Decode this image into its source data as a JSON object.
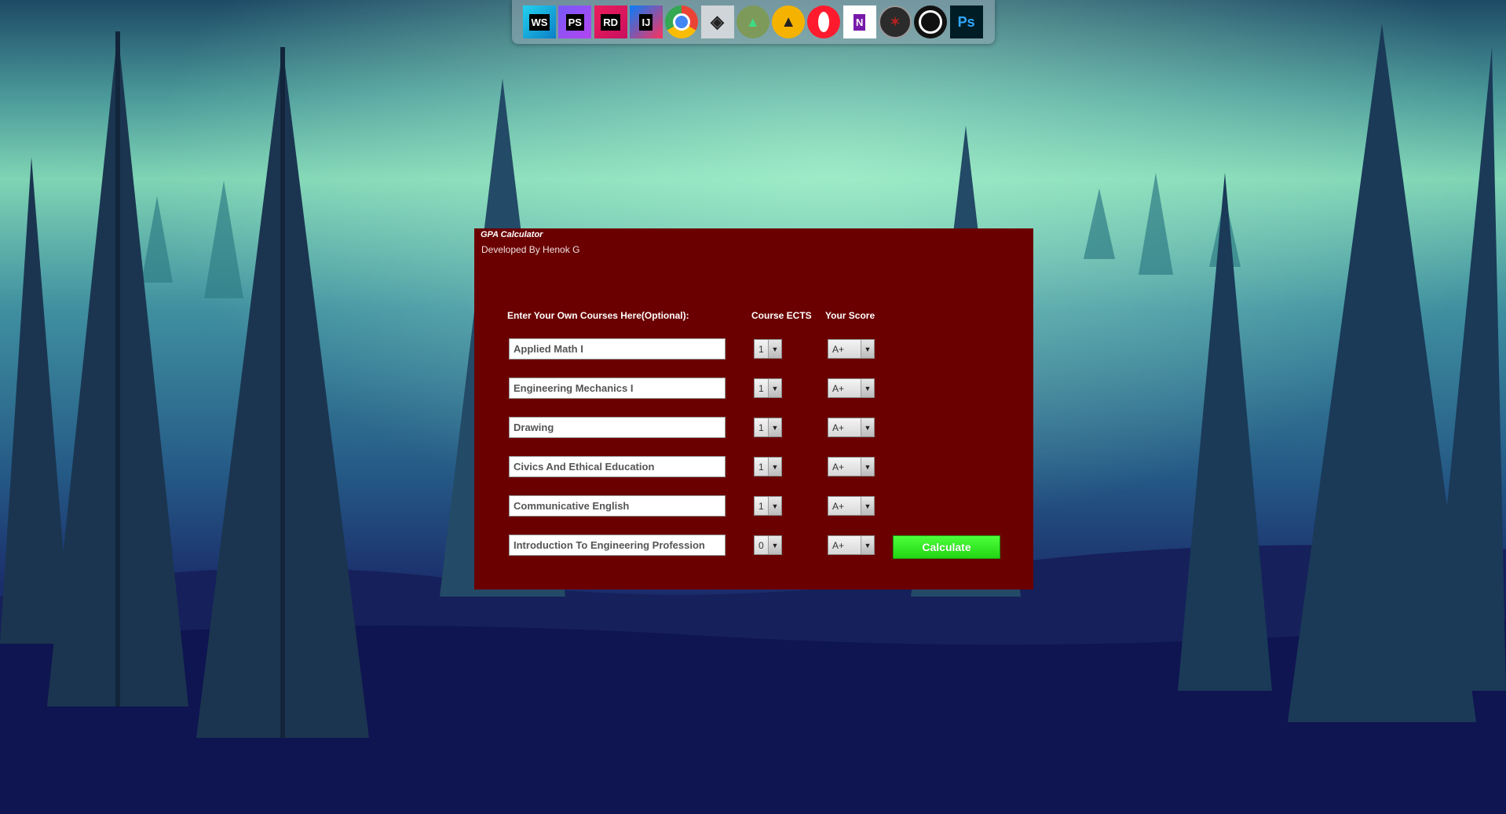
{
  "dock": {
    "icons": [
      {
        "name": "webstorm-icon",
        "label": "WS",
        "bg": "#0b7fc7",
        "accent": "#22d1ee"
      },
      {
        "name": "phpstorm-icon",
        "label": "PS",
        "bg": "#b345f1",
        "accent": "#765af8"
      },
      {
        "name": "rider-icon",
        "label": "RD",
        "bg": "#c90f5e",
        "accent": "#ec1d5c"
      },
      {
        "name": "intellij-icon",
        "label": "IJ",
        "bg": "#fe315d",
        "accent": "#087cfa"
      },
      {
        "name": "chrome-icon",
        "label": "",
        "bg": "#ffffff",
        "accent": "#4285f4"
      },
      {
        "name": "unity-icon",
        "label": "",
        "bg": "#cfd5d8",
        "accent": "#222222"
      },
      {
        "name": "android-studio-icon",
        "label": "",
        "bg": "#7d9a5a",
        "accent": "#3ddc84"
      },
      {
        "name": "aimp-icon",
        "label": "",
        "bg": "#f5b300",
        "accent": "#222222"
      },
      {
        "name": "opera-icon",
        "label": "",
        "bg": "#ff1b2d",
        "accent": "#a70014"
      },
      {
        "name": "onenote-icon",
        "label": "N",
        "bg": "#7719aa",
        "accent": "#ca64ea"
      },
      {
        "name": "witcher-icon",
        "label": "",
        "bg": "#2b2b2b",
        "accent": "#b22222"
      },
      {
        "name": "obs-icon",
        "label": "",
        "bg": "#111111",
        "accent": "#ffffff"
      },
      {
        "name": "photoshop-icon",
        "label": "Ps",
        "bg": "#001d26",
        "accent": "#31a8ff"
      }
    ]
  },
  "app": {
    "title": "GPA Calculator",
    "subtitle": "Developed By Henok G",
    "headers": {
      "courses": "Enter Your Own Courses Here(Optional):",
      "ects": "Course ECTS",
      "score": "Your Score"
    },
    "rows": [
      {
        "course": "Applied Math I",
        "ects": "1",
        "score": "A+"
      },
      {
        "course": "Engineering Mechanics I",
        "ects": "1",
        "score": "A+"
      },
      {
        "course": "Drawing",
        "ects": "1",
        "score": "A+"
      },
      {
        "course": "Civics And Ethical Education",
        "ects": "1",
        "score": "A+"
      },
      {
        "course": "Communicative English",
        "ects": "1",
        "score": "A+"
      },
      {
        "course": "Introduction To Engineering Profession",
        "ects": "0",
        "score": "A+"
      }
    ],
    "calculate_label": "Calculate",
    "colors": {
      "window_bg": "#6b0000",
      "button": "#2ee81f"
    }
  }
}
